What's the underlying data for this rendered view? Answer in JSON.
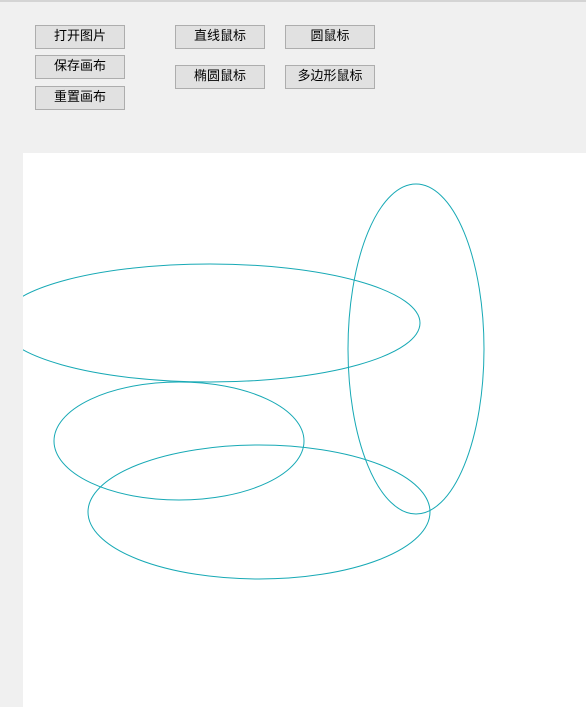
{
  "toolbar": {
    "open_image": "打开图片",
    "save_canvas": "保存画布",
    "reset_canvas": "重置画布",
    "line_mouse": "直线鼠标",
    "circle_mouse": "圆鼠标",
    "ellipse_mouse": "椭圆鼠标",
    "polygon_mouse": "多边形鼠标"
  },
  "colors": {
    "stroke": "#17a9b5",
    "canvas_bg": "#ffffff",
    "window_bg": "#f0f0f0"
  },
  "drawings": {
    "type": "ellipse"
  }
}
